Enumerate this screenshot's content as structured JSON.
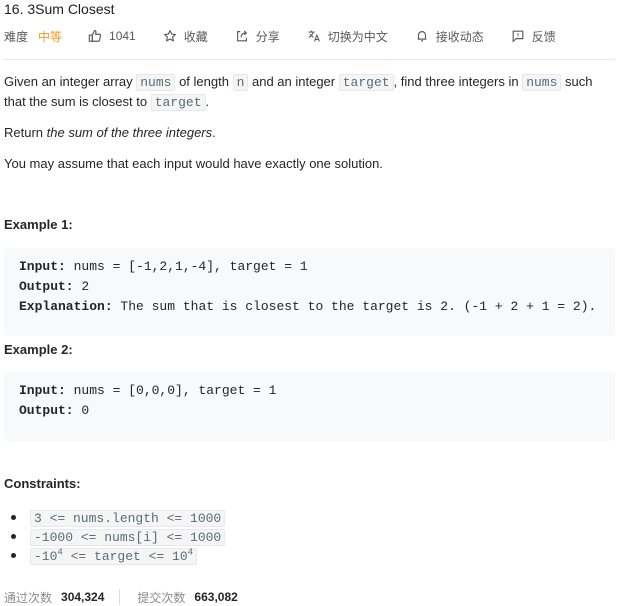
{
  "problem": {
    "title": "16. 3Sum Closest"
  },
  "toolbar": {
    "difficulty_label": "难度",
    "difficulty_value": "中等",
    "difficulty_color": "#ef9c21",
    "likes": "1041",
    "favorite_label": "收藏",
    "share_label": "分享",
    "switch_lang_label": "切换为中文",
    "subscribe_label": "接收动态",
    "feedback_label": "反馈"
  },
  "description": {
    "p1_a": "Given an integer array ",
    "p1_code1": "nums",
    "p1_b": " of length ",
    "p1_code2": "n",
    "p1_c": " and an integer ",
    "p1_code3": "target",
    "p1_d": ", find three integers in ",
    "p1_code4": "nums",
    "p1_e": " such that the sum is closest to ",
    "p1_code5": "target",
    "p1_f": ".",
    "p2_a": "Return ",
    "p2_em": "the sum of the three integers",
    "p2_b": ".",
    "p3": "You may assume that each input would have exactly one solution."
  },
  "examples": [
    {
      "heading": "Example 1:",
      "input_label": "Input:",
      "input": " nums = [-1,2,1,-4], target = 1",
      "output_label": "Output:",
      "output": " 2",
      "explanation_label": "Explanation:",
      "explanation": " The sum that is closest to the target is 2. (-1 + 2 + 1 = 2)."
    },
    {
      "heading": "Example 2:",
      "input_label": "Input:",
      "input": " nums = [0,0,0], target = 1",
      "output_label": "Output:",
      "output": " 0"
    }
  ],
  "constraints": {
    "heading": "Constraints:",
    "c1": "3 <= nums.length <= 1000",
    "c2": "-1000 <= nums[i] <= 1000",
    "c3_a": "-10",
    "c3_sup1": "4",
    "c3_b": " <= target <= 10",
    "c3_sup2": "4"
  },
  "footer": {
    "accepted_label": "通过次数",
    "accepted_value": "304,324",
    "submissions_label": "提交次数",
    "submissions_value": "663,082"
  }
}
